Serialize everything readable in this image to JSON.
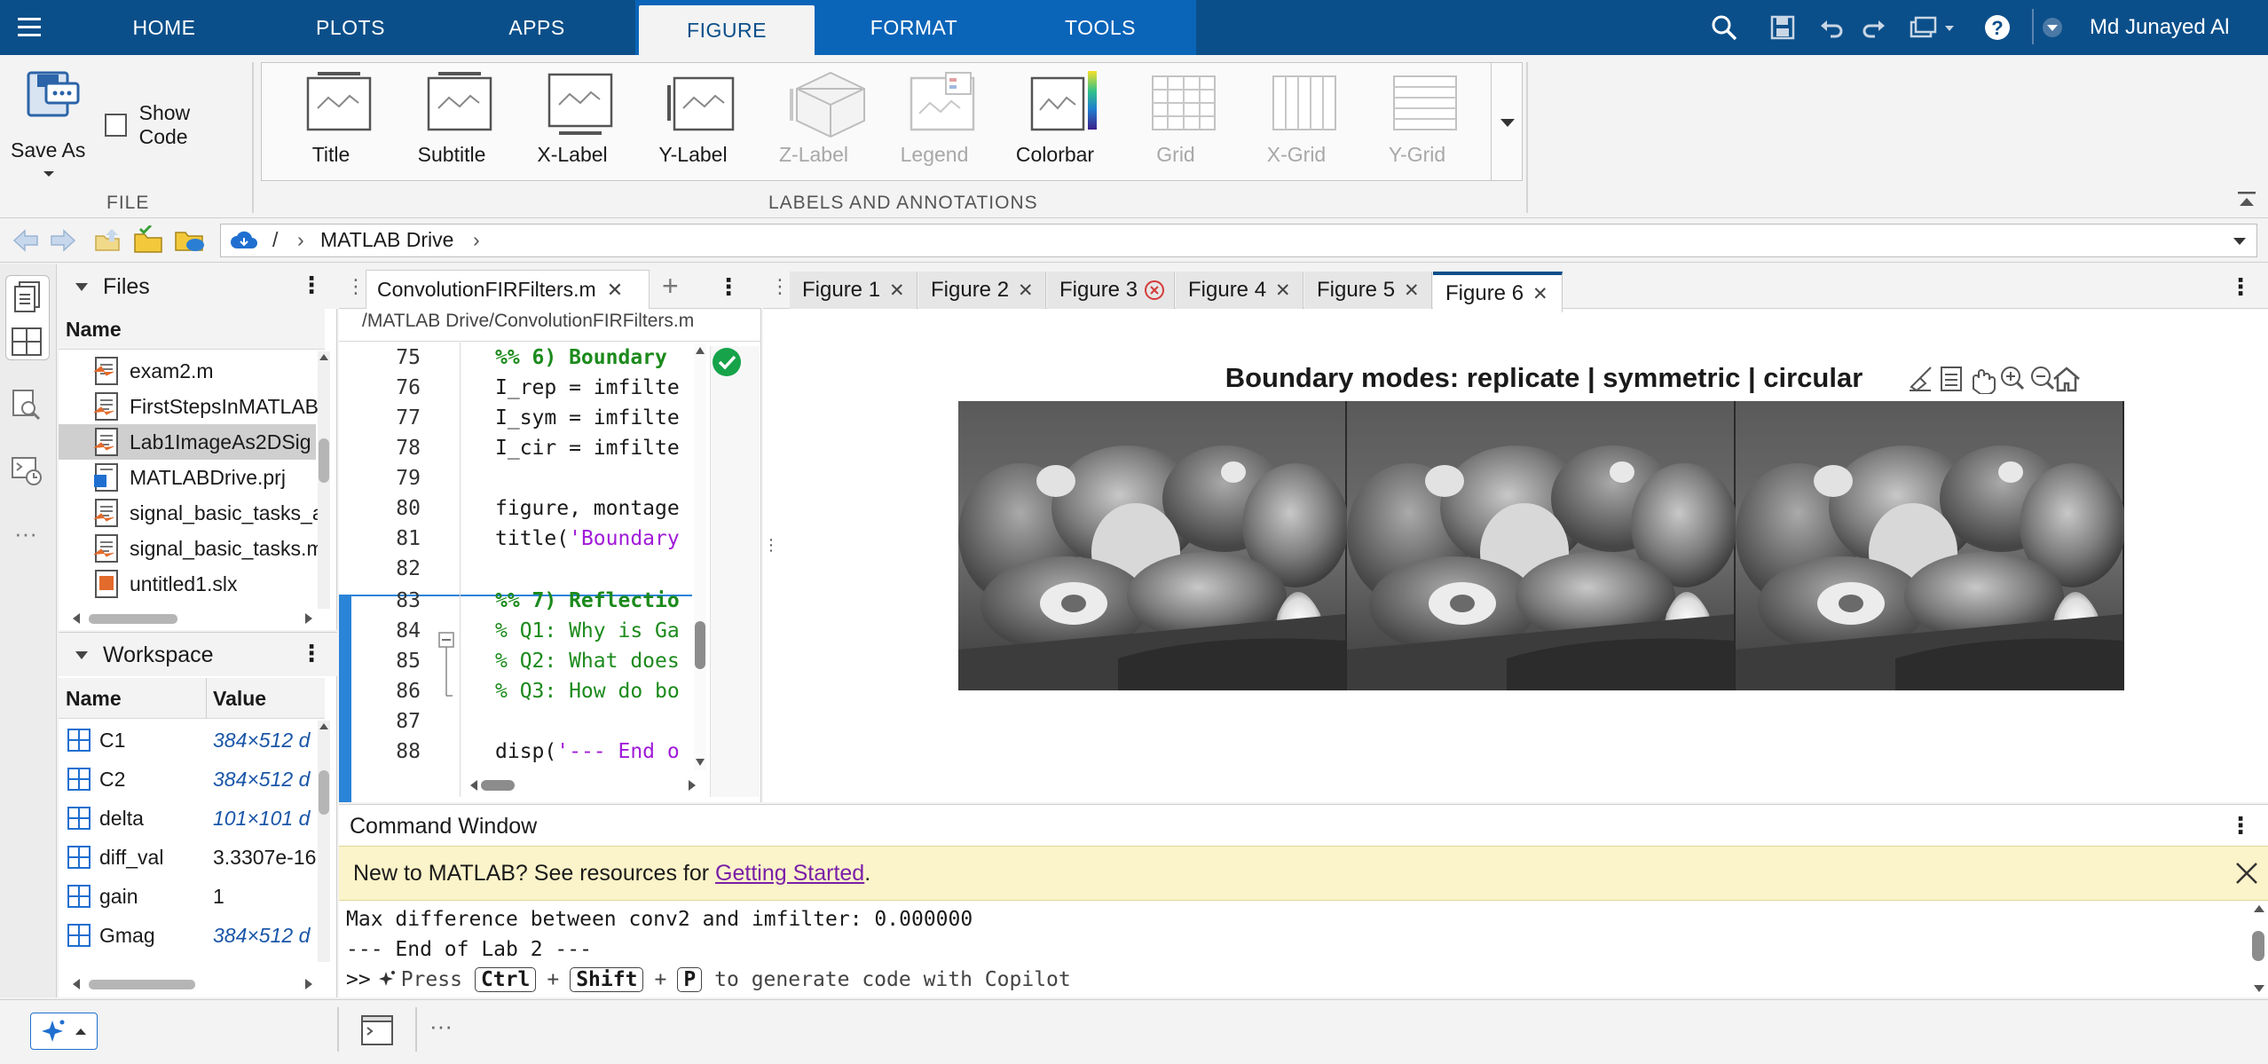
{
  "topbar": {
    "tabs": [
      "HOME",
      "PLOTS",
      "APPS",
      "FIGURE",
      "FORMAT",
      "TOOLS"
    ],
    "active_tab": "FIGURE",
    "user": "Md Junayed Al"
  },
  "ribbon": {
    "save_as": "Save As",
    "show_code": "Show Code",
    "file_section": "FILE",
    "labels_section": "LABELS AND ANNOTATIONS",
    "gallery": [
      {
        "label": "Title",
        "enabled": true
      },
      {
        "label": "Subtitle",
        "enabled": true
      },
      {
        "label": "X-Label",
        "enabled": true
      },
      {
        "label": "Y-Label",
        "enabled": true
      },
      {
        "label": "Z-Label",
        "enabled": false
      },
      {
        "label": "Legend",
        "enabled": false
      },
      {
        "label": "Colorbar",
        "enabled": true
      },
      {
        "label": "Grid",
        "enabled": false
      },
      {
        "label": "X-Grid",
        "enabled": false
      },
      {
        "label": "Y-Grid",
        "enabled": false
      }
    ]
  },
  "address": {
    "root": "/",
    "folder": "MATLAB Drive"
  },
  "files_panel": {
    "title": "Files",
    "column": "Name",
    "items": [
      {
        "name": "exam2.m",
        "type": "m"
      },
      {
        "name": "FirstStepsInMATLAB",
        "type": "mlx"
      },
      {
        "name": "Lab1ImageAs2DSig",
        "type": "mlx",
        "selected": true
      },
      {
        "name": "MATLABDrive.prj",
        "type": "prj"
      },
      {
        "name": "signal_basic_tasks_a",
        "type": "mlx"
      },
      {
        "name": "signal_basic_tasks.m",
        "type": "mlx"
      },
      {
        "name": "untitled1.slx",
        "type": "slx"
      }
    ]
  },
  "workspace": {
    "title": "Workspace",
    "col_name": "Name",
    "col_value": "Value",
    "rows": [
      {
        "name": "C1",
        "value": "384×512 d",
        "italic": true
      },
      {
        "name": "C2",
        "value": "384×512 d",
        "italic": true
      },
      {
        "name": "delta",
        "value": "101×101 d",
        "italic": true
      },
      {
        "name": "diff_val",
        "value": "3.3307e-16",
        "italic": false
      },
      {
        "name": "gain",
        "value": "1",
        "italic": false
      },
      {
        "name": "Gmag",
        "value": "384×512 d",
        "italic": true
      }
    ]
  },
  "editor": {
    "tab": "ConvolutionFIRFilters.m",
    "path": "/MATLAB Drive/ConvolutionFIRFilters.m",
    "lines": [
      {
        "n": "75",
        "text": "%% 6) Boundary",
        "kind": "section"
      },
      {
        "n": "76",
        "text": "I_rep = imfilte",
        "kind": "code"
      },
      {
        "n": "77",
        "text": "I_sym = imfilte",
        "kind": "code"
      },
      {
        "n": "78",
        "text": "I_cir = imfilte",
        "kind": "code"
      },
      {
        "n": "79",
        "text": "",
        "kind": "code"
      },
      {
        "n": "80",
        "text": "figure, montage",
        "kind": "code"
      },
      {
        "n": "81",
        "text_a": "title(",
        "text_b": "'Boundary",
        "kind": "title"
      },
      {
        "n": "82",
        "text": "",
        "kind": "code"
      },
      {
        "n": "83",
        "text": "%% 7) Reflectio",
        "kind": "section"
      },
      {
        "n": "84",
        "text": "% Q1: Why is Ga",
        "kind": "comment"
      },
      {
        "n": "85",
        "text": "% Q2: What does",
        "kind": "comment"
      },
      {
        "n": "86",
        "text": "% Q3: How do bo",
        "kind": "comment"
      },
      {
        "n": "87",
        "text": "",
        "kind": "code"
      },
      {
        "n": "88",
        "text_a": "disp(",
        "text_b": "'--- End o",
        "kind": "title"
      }
    ]
  },
  "figures": {
    "tabs": [
      "Figure 1",
      "Figure 2",
      "Figure 3",
      "Figure 4",
      "Figure 5",
      "Figure 6"
    ],
    "active": "Figure 6",
    "plot_title": "Boundary modes: replicate | symmetric | circular"
  },
  "command_window": {
    "title": "Command Window",
    "banner_text": "New to MATLAB? See resources for ",
    "banner_link": "Getting Started",
    "banner_end": ".",
    "output": [
      "Max difference between conv2 and imfilter: 0.000000",
      "--- End of Lab 2 ---"
    ],
    "prompt": ">>",
    "hint_press": "Press",
    "key_ctrl": "Ctrl",
    "key_shift": "Shift",
    "key_p": "P",
    "hint_plus": "+",
    "hint_rest": "to generate code with Copilot"
  }
}
